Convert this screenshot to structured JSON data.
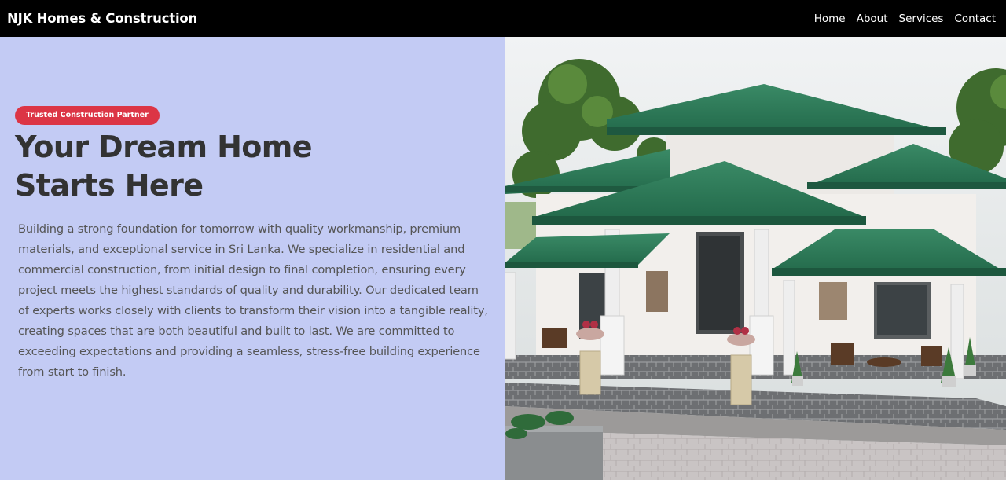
{
  "navbar": {
    "brand": "NJK Homes & Construction",
    "links": [
      "Home",
      "About",
      "Services",
      "Contact"
    ]
  },
  "hero": {
    "badge": "Trusted Construction Partner",
    "title_line1": "Your Dream Home",
    "title_line2": "Starts Here",
    "description": "Building a strong foundation for tomorrow with quality workmanship, premium materials, and exceptional service in Sri Lanka. We specialize in residential and commercial construction, from initial design to final completion, ensuring every project meets the highest standards of quality and durability. Our dedicated team of experts works closely with clients to transform their vision into a tangible reality, creating spaces that are both beautiful and built to last. We are committed to exceeding expectations and providing a seamless, stress-free building experience from start to finish.",
    "image_alt": "house-rendering"
  },
  "colors": {
    "nav_bg": "#000000",
    "hero_bg": "#c3cbf4",
    "badge_bg": "#dc3545",
    "roof_green": "#2f7d5c",
    "heading": "#333333"
  }
}
